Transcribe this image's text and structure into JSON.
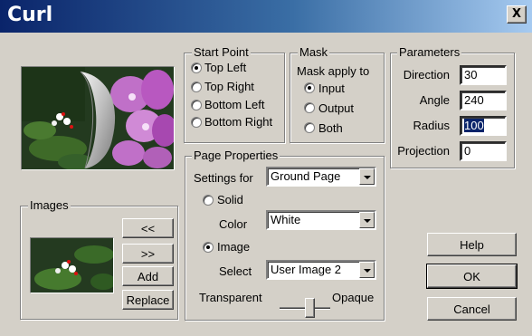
{
  "window": {
    "title": "Curl",
    "close_glyph": "X"
  },
  "start_point": {
    "legend": "Start Point",
    "options": [
      "Top Left",
      "Top Right",
      "Bottom Left",
      "Bottom Right"
    ],
    "selected": "Top Left"
  },
  "mask": {
    "legend": "Mask",
    "caption": "Mask apply to",
    "options": [
      "Input",
      "Output",
      "Both"
    ],
    "selected": "Input"
  },
  "parameters": {
    "legend": "Parameters",
    "direction_label": "Direction",
    "direction_value": "30",
    "angle_label": "Angle",
    "angle_value": "240",
    "radius_label": "Radius",
    "radius_value": "100",
    "projection_label": "Projection",
    "projection_value": "0"
  },
  "page_properties": {
    "legend": "Page Properties",
    "settings_for_label": "Settings for",
    "settings_for_value": "Ground Page",
    "solid_label": "Solid",
    "color_label": "Color",
    "color_value": "White",
    "image_label": "Image",
    "select_label": "Select",
    "select_value": "User Image 2",
    "transparent_label": "Transparent",
    "opaque_label": "Opaque",
    "opacity_level": 0.63,
    "selected_fill": "Image"
  },
  "images": {
    "legend": "Images",
    "prev_label": "<<",
    "next_label": ">>",
    "add_label": "Add",
    "replace_label": "Replace"
  },
  "buttons": {
    "help": "Help",
    "ok": "OK",
    "cancel": "Cancel"
  },
  "icons": [
    "close-icon",
    "dropdown-arrow-icon"
  ]
}
